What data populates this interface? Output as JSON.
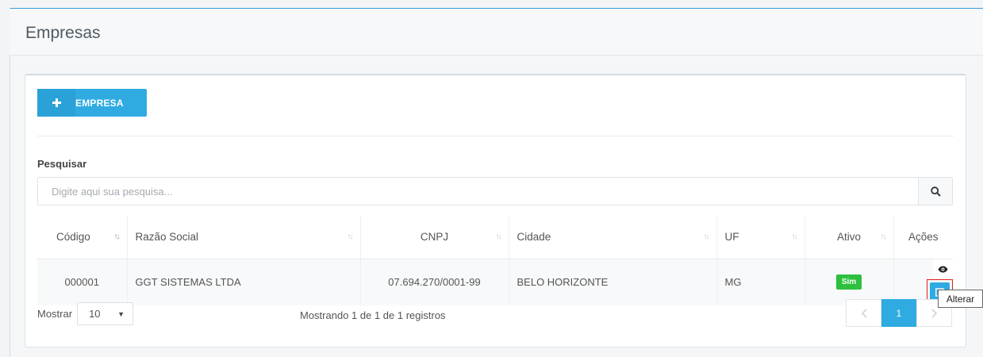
{
  "page": {
    "title": "Empresas"
  },
  "toolbar": {
    "add_label": "EMPRESA",
    "add_icon": "plus-icon"
  },
  "search": {
    "label": "Pesquisar",
    "placeholder": "Digite aqui sua pesquisa...",
    "value": ""
  },
  "table": {
    "columns": [
      "Código",
      "Razão Social",
      "CNPJ",
      "Cidade",
      "UF",
      "Ativo",
      "Ações"
    ],
    "rows": [
      {
        "codigo": "000001",
        "razao_social": "GGT SISTEMAS LTDA",
        "cnpj": "07.694.270/0001-99",
        "cidade": "BELO HORIZONTE",
        "uf": "MG",
        "ativo": "Sim"
      }
    ]
  },
  "footer": {
    "show_label": "Mostrar",
    "page_size": "10",
    "info": "Mostrando 1 de 1 de 1 registros",
    "current_page": "1"
  },
  "tooltip": {
    "text": "Alterar"
  },
  "colors": {
    "accent": "#2fabe2",
    "success": "#2dc03f",
    "top_border": "#3c9be0"
  }
}
